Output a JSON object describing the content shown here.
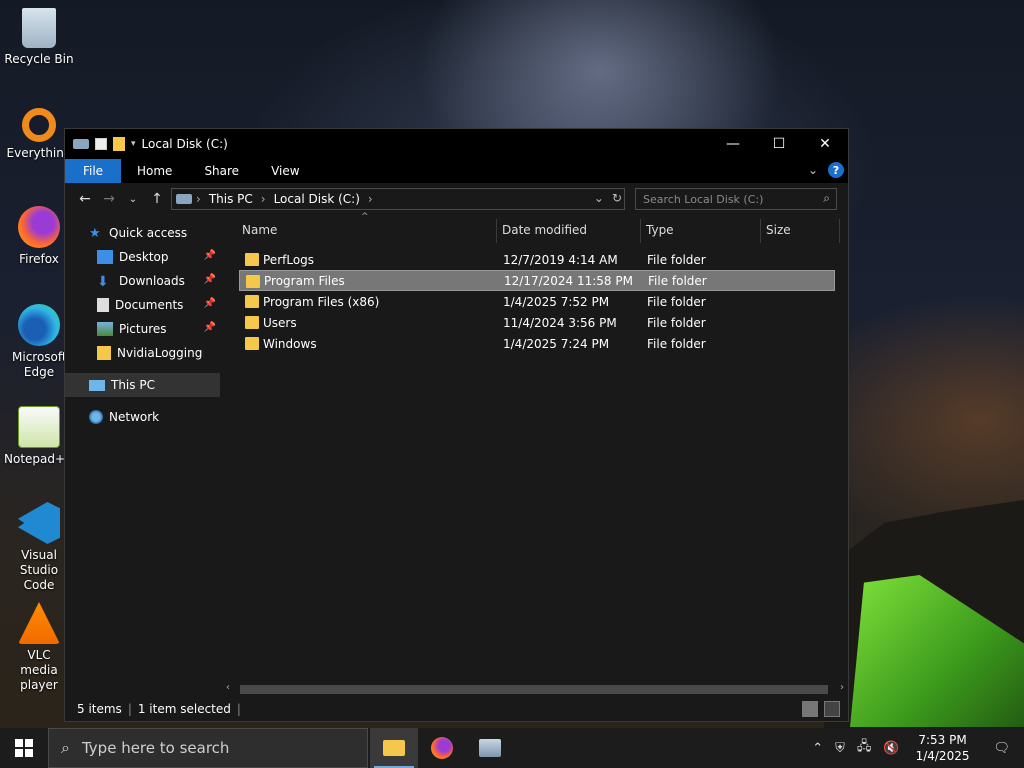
{
  "desktop": {
    "icons": [
      {
        "label": "Recycle Bin"
      },
      {
        "label": "Everything"
      },
      {
        "label": "Firefox"
      },
      {
        "label": "Microsoft Edge"
      },
      {
        "label": "Notepad++"
      },
      {
        "label": "Visual Studio Code"
      },
      {
        "label": "VLC media player"
      }
    ]
  },
  "window": {
    "title": "Local Disk (C:)",
    "controls": {
      "minimize": "—",
      "maximize": "☐",
      "close": "✕"
    },
    "ribbon": {
      "tabs": [
        "File",
        "Home",
        "Share",
        "View"
      ],
      "help": "?"
    },
    "address": {
      "crumbs": [
        "This PC",
        "Local Disk (C:)"
      ]
    },
    "search": {
      "placeholder": "Search Local Disk (C:)"
    },
    "sidebar": {
      "quick_access": "Quick access",
      "pinned": [
        "Desktop",
        "Downloads",
        "Documents",
        "Pictures"
      ],
      "other": "NvidiaLogging",
      "this_pc": "This PC",
      "network": "Network"
    },
    "columns": {
      "name": "Name",
      "date": "Date modified",
      "type": "Type",
      "size": "Size"
    },
    "files": [
      {
        "name": "PerfLogs",
        "date": "12/7/2019 4:14 AM",
        "type": "File folder"
      },
      {
        "name": "Program Files",
        "date": "12/17/2024 11:58 PM",
        "type": "File folder"
      },
      {
        "name": "Program Files (x86)",
        "date": "1/4/2025 7:52 PM",
        "type": "File folder"
      },
      {
        "name": "Users",
        "date": "11/4/2024 3:56 PM",
        "type": "File folder"
      },
      {
        "name": "Windows",
        "date": "1/4/2025 7:24 PM",
        "type": "File folder"
      }
    ],
    "status": {
      "items": "5 items",
      "selected": "1 item selected"
    }
  },
  "taskbar": {
    "search_placeholder": "Type here to search",
    "clock_time": "7:53 PM",
    "clock_date": "1/4/2025"
  },
  "colors": {
    "accent": "#1a6fc9",
    "folder": "#f5c74b"
  }
}
